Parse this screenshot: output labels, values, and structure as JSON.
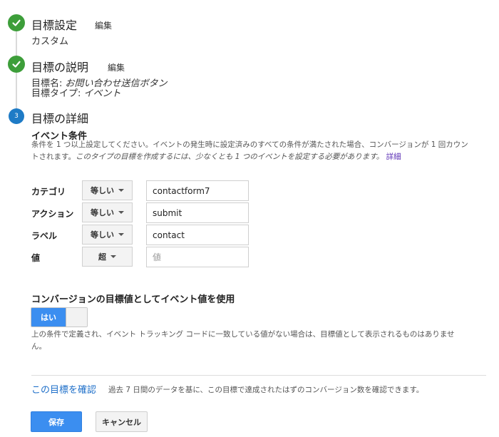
{
  "steps": [
    {
      "title": "目標設定",
      "edit_label": "編集",
      "detail": "カスタム"
    },
    {
      "title": "目標の説明",
      "edit_label": "編集",
      "name_label": "目標名:",
      "name_value": "お問い合わせ送信ボタン",
      "type_label": "目標タイプ:",
      "type_value": "イベント"
    },
    {
      "number": "3",
      "title": "目標の詳細"
    }
  ],
  "event_conditions": {
    "title": "イベント条件",
    "desc_line1": "条件を 1 つ以上設定してください。イベントの発生時に設定済みのすべての条件が満たされた場合、コンバージョンが 1 回カウン",
    "desc_line2_a": "トされます。",
    "desc_line2_italic": "このタイプの目標を作成するには、少なくとも 1 つのイベントを設定する必要があります。",
    "details_link": "詳細",
    "rows": [
      {
        "label": "カテゴリ",
        "operator": "等しい",
        "value": "contactform7",
        "placeholder": ""
      },
      {
        "label": "アクション",
        "operator": "等しい",
        "value": "submit",
        "placeholder": ""
      },
      {
        "label": "ラベル",
        "operator": "等しい",
        "value": "contact",
        "placeholder": ""
      },
      {
        "label": "値",
        "operator": "超",
        "value": "",
        "placeholder": "値"
      }
    ]
  },
  "conversion_value": {
    "title": "コンバージョンの目標値としてイベント値を使用",
    "toggle_label": "はい",
    "toggle_on": true,
    "note_line1": "上の条件で定義され、イベント トラッキング コードに一致している値がない場合は、目標値として表示されるものはありませ",
    "note_line2": "ん。"
  },
  "verify": {
    "link": "この目標を確認",
    "desc": "過去 7 日間のデータを基に、この目標で達成されたはずのコンバージョン数を確認できます。"
  },
  "buttons": {
    "save": "保存",
    "cancel": "キャンセル"
  },
  "colors": {
    "check_green": "#3d9e3a",
    "step_blue": "#1e7bc6",
    "primary_blue": "#3b8ef0",
    "link_blue": "#1e6fc9",
    "link_purple": "#5b2fb5"
  }
}
